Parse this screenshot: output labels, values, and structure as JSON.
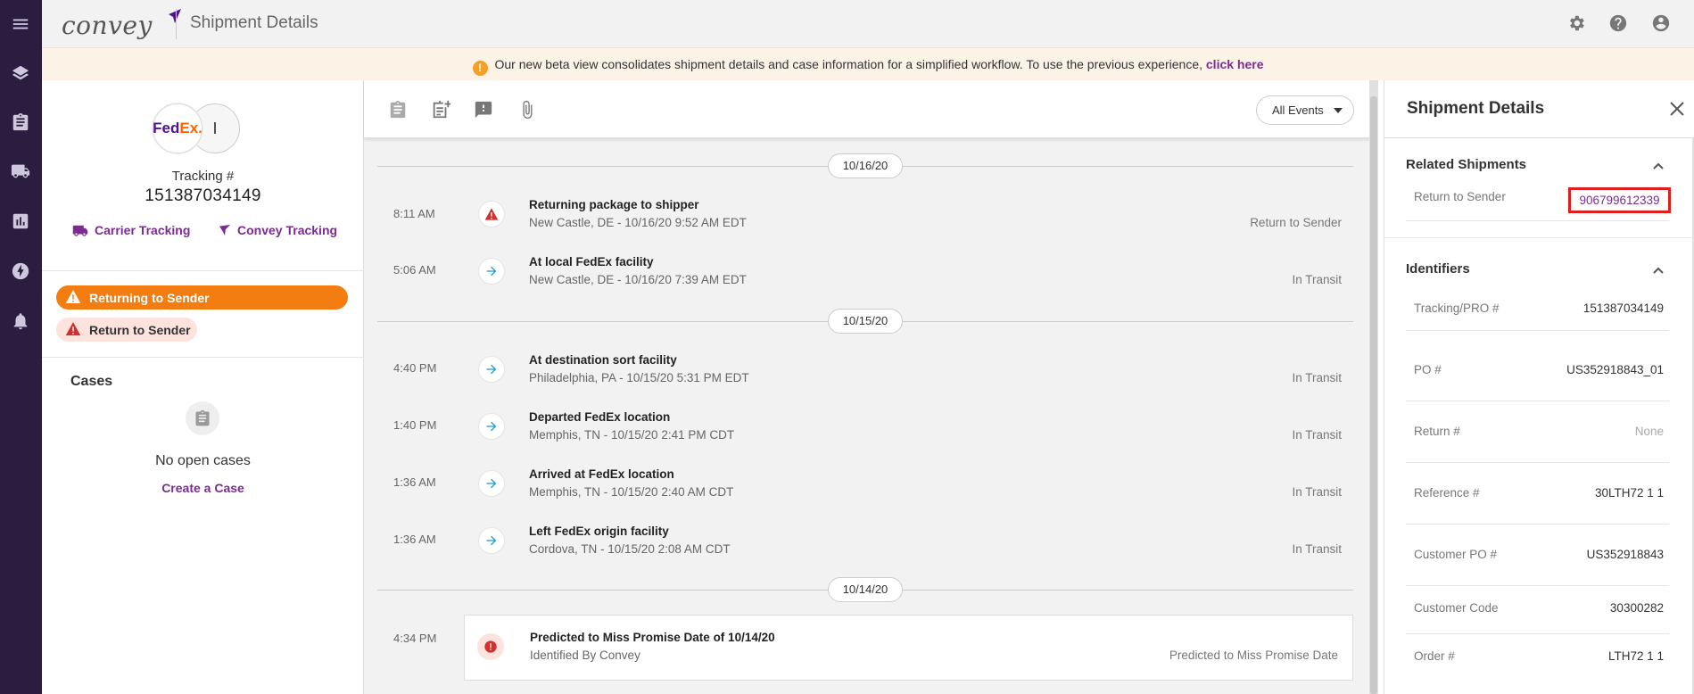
{
  "app": {
    "page_title": "Shipment Details",
    "logo_text": "convey"
  },
  "nav": {
    "items": [
      "menu-icon",
      "layers-icon",
      "clipboard-icon",
      "truck-icon",
      "bar-chart-icon",
      "lightning-icon",
      "bell-icon"
    ]
  },
  "topbar": {
    "icons": [
      "gear-icon",
      "help-icon",
      "account-icon"
    ]
  },
  "banner": {
    "text": "Our new beta view consolidates shipment details and case information for a simplified workflow. To use the previous experience,",
    "link": "click here"
  },
  "shipment": {
    "carrier_logo": {
      "part1": "Fed",
      "part2": "Ex",
      "suffix": "."
    },
    "initial": "I",
    "tracking_label": "Tracking #",
    "tracking_number": "151387034149",
    "carrier_tracking": "Carrier Tracking",
    "convey_tracking": "Convey Tracking",
    "badges": [
      "Returning to Sender",
      "Return to Sender"
    ]
  },
  "cases": {
    "title": "Cases",
    "empty": "No open cases",
    "create": "Create a Case"
  },
  "events": {
    "filter": "All Events",
    "dates": [
      "10/16/20",
      "10/15/20",
      "10/14/20"
    ],
    "list": [
      {
        "time": "8:11 AM",
        "title": "Returning package to shipper",
        "sub": "New Castle, DE - 10/16/20 9:52 AM EDT",
        "status": "Return to Sender",
        "icon": "warning-icon"
      },
      {
        "time": "5:06 AM",
        "title": "At local FedEx facility",
        "sub": "New Castle, DE - 10/16/20 7:39 AM EDT",
        "status": "In Transit",
        "icon": "arrow-right-icon"
      },
      {
        "time": "4:40 PM",
        "title": "At destination sort facility",
        "sub": "Philadelphia, PA - 10/15/20 5:31 PM EDT",
        "status": "In Transit",
        "icon": "arrow-right-icon"
      },
      {
        "time": "1:40 PM",
        "title": "Departed FedEx location",
        "sub": "Memphis, TN - 10/15/20 2:41 PM CDT",
        "status": "In Transit",
        "icon": "arrow-right-icon"
      },
      {
        "time": "1:36 AM",
        "title": "Arrived at FedEx location",
        "sub": "Memphis, TN - 10/15/20 2:40 AM CDT",
        "status": "In Transit",
        "icon": "arrow-right-icon"
      },
      {
        "time": "1:36 AM",
        "title": "Left FedEx origin facility",
        "sub": "Cordova, TN - 10/15/20 2:08 AM CDT",
        "status": "In Transit",
        "icon": "arrow-right-icon"
      },
      {
        "time": "4:34 PM",
        "title": "Predicted to Miss Promise Date of 10/14/20",
        "sub": "Identified By Convey",
        "status": "Predicted to Miss Promise Date",
        "icon": "alert-circle-icon"
      }
    ]
  },
  "details": {
    "title": "Shipment Details",
    "related": {
      "title": "Related Shipments",
      "label": "Return to Sender",
      "value": "906799612339"
    },
    "identifiers": {
      "title": "Identifiers",
      "rows": [
        {
          "label": "Tracking/PRO #",
          "value": "151387034149"
        },
        {
          "label": "PO #",
          "value": "US352918843_01"
        },
        {
          "label": "Return #",
          "value": "None"
        },
        {
          "label": "Reference #",
          "value": "30LTH72 1 1"
        },
        {
          "label": "Customer PO #",
          "value": "US352918843"
        },
        {
          "label": "Customer Code",
          "value": "30300282"
        },
        {
          "label": "Order #",
          "value": "LTH72 1 1"
        }
      ]
    }
  },
  "colors": {
    "nav_bg": "#2a1d40",
    "accent": "#7a2c90",
    "orange": "#f37d11",
    "alert_red": "#d32f2f",
    "transit_blue": "#1e9bd7",
    "highlight": "#e01e1e"
  }
}
